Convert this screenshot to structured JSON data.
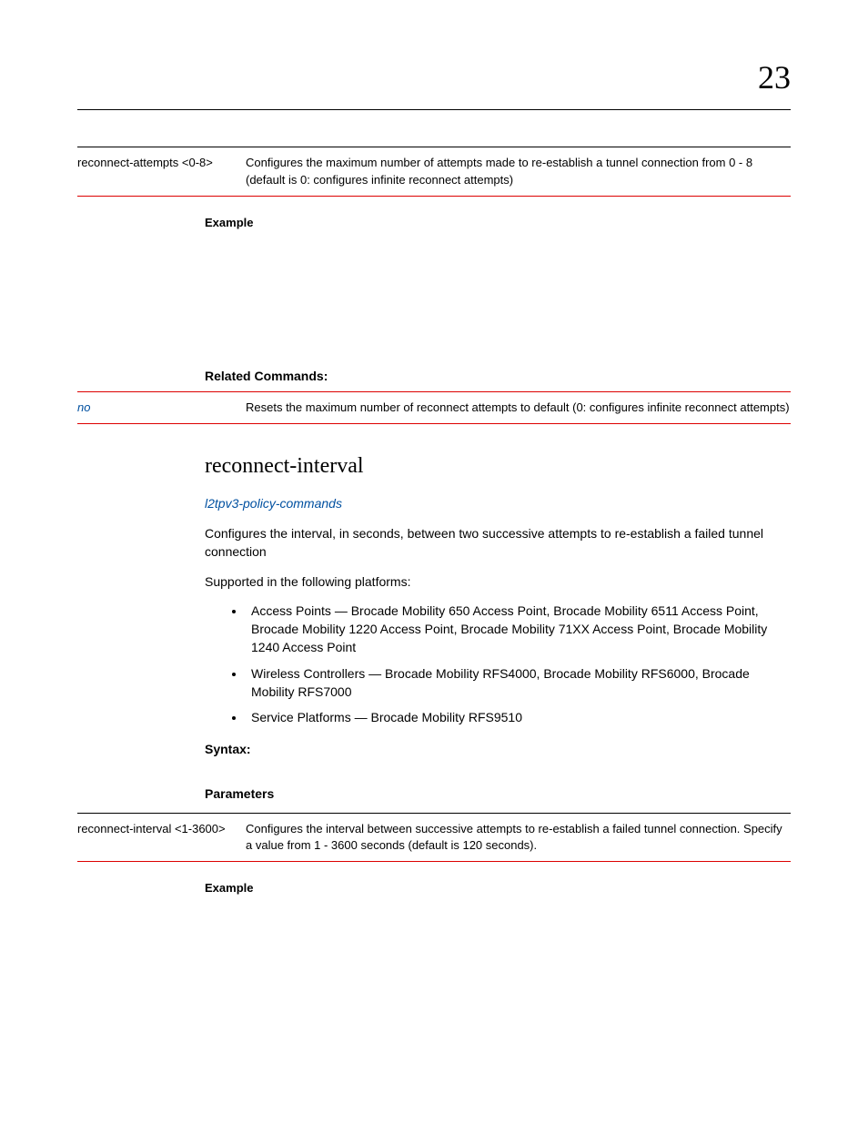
{
  "chapterNumber": "23",
  "table1": {
    "param": "reconnect-attempts <0-8>",
    "desc": "Configures the maximum number of attempts made to re-establish a tunnel connection from 0 - 8 (default is 0: configures infinite reconnect attempts)"
  },
  "exampleLabel1": "Example",
  "relatedCommandsLabel": "Related Commands:",
  "table2": {
    "param": "no",
    "desc": "Resets the maximum number of reconnect attempts to default (0: configures infinite reconnect attempts)"
  },
  "commandTitle": "reconnect-interval",
  "policyLink": "l2tpv3-policy-commands",
  "description": "Configures the interval, in seconds, between two successive attempts to re-establish a failed tunnel connection",
  "supportedLabel": "Supported in the following platforms:",
  "platforms": [
    "Access Points — Brocade Mobility 650 Access Point, Brocade Mobility 6511 Access Point, Brocade Mobility 1220 Access Point, Brocade Mobility 71XX Access Point, Brocade Mobility 1240 Access Point",
    "Wireless Controllers — Brocade Mobility RFS4000, Brocade Mobility RFS6000, Brocade Mobility RFS7000",
    "Service Platforms — Brocade Mobility RFS9510"
  ],
  "syntaxLabel": "Syntax:",
  "parametersLabel": "Parameters",
  "table3": {
    "param": "reconnect-interval <1-3600>",
    "desc": "Configures the interval between successive attempts to re-establish a failed tunnel connection. Specify a value from 1 - 3600 seconds (default is 120 seconds)."
  },
  "exampleLabel2": "Example"
}
